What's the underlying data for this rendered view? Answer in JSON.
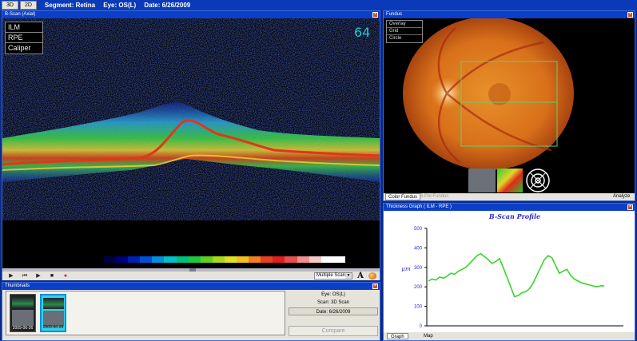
{
  "topbar": {
    "tabs": [
      "3D",
      "2D"
    ],
    "segment": "Segment: Retina",
    "eye": "Eye: OS(L)",
    "date": "Date: 6/26/2009"
  },
  "bscan": {
    "title": "B-Scan (Axial)",
    "layers": [
      "ILM",
      "RPE",
      "Caliper"
    ],
    "frame_number": "64",
    "scan_mode": "Multiple Scans",
    "tool_text": "A"
  },
  "fundus": {
    "title": "Fundus",
    "menu": [
      "Overlay",
      "Grid",
      "Circle"
    ],
    "tabs": [
      "Color Fundus",
      "B-Pol Fundus",
      "Analyze"
    ]
  },
  "thickness": {
    "title": "Thickness Graph  ( ILM - RPE )",
    "tabs": [
      "Graph",
      "Map"
    ]
  },
  "chart_data": {
    "type": "line",
    "title": "B-Scan Profile",
    "xlabel": "",
    "ylabel": "µm",
    "ylim": [
      0,
      500
    ],
    "yticks": [
      0,
      100,
      200,
      300,
      400,
      500
    ],
    "series": [
      {
        "values": [
          230,
          240,
          235,
          250,
          245,
          255,
          270,
          265,
          280,
          290,
          300,
          320,
          340,
          360,
          370,
          355,
          340,
          320,
          330,
          345,
          300,
          250,
          200,
          150,
          155,
          170,
          175,
          190,
          220,
          260,
          300,
          340,
          360,
          350,
          310,
          270,
          280,
          290,
          260,
          240,
          230,
          220,
          215,
          210,
          205,
          200,
          205,
          205
        ]
      }
    ],
    "color": "#3ad42a"
  },
  "thumbnails": {
    "title": "Thumbnails",
    "items": [
      {
        "date": "2009-06-26",
        "selected": false
      },
      {
        "date": "2009-06-26",
        "selected": true
      }
    ],
    "info": {
      "eye": "Eye: OS(L)",
      "scan": "Scan: 3D Scan",
      "date": "Date: 6/26/2009"
    },
    "compare_label": "Compare"
  },
  "colors": {
    "title_bar": "#0c3fc7",
    "accent_cyan": "#28c6c8",
    "chart_line": "#3ad42a"
  }
}
